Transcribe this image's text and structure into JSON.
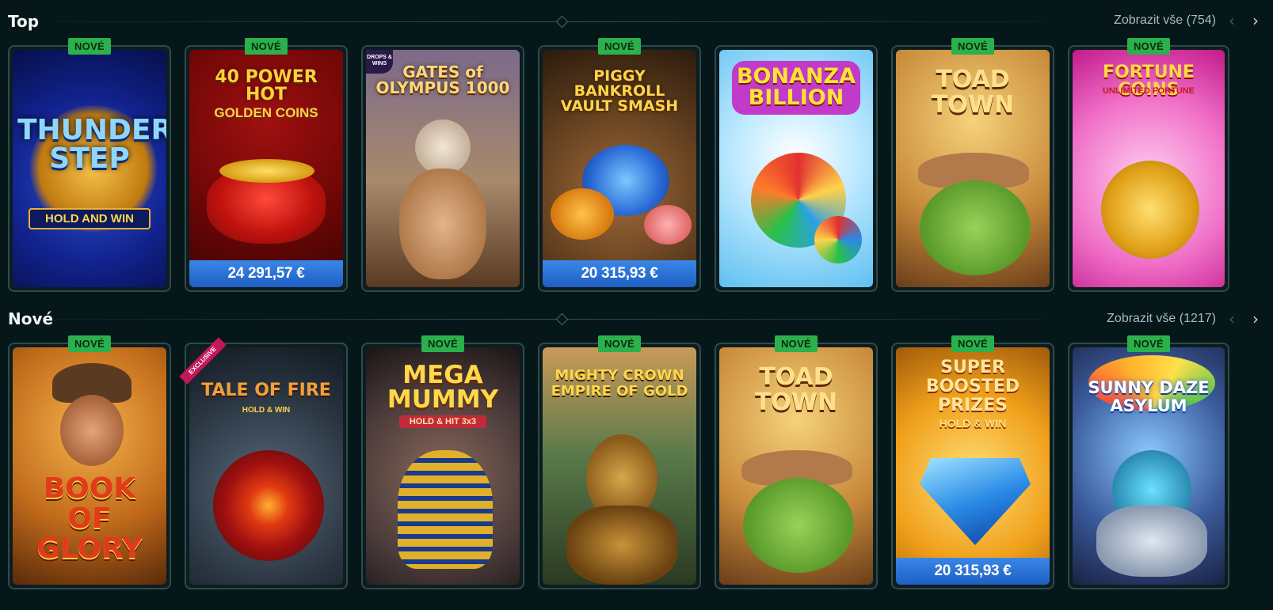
{
  "badge_label": "NOVÉ",
  "sections": {
    "top": {
      "title": "Top",
      "view_all": "Zobrazit vše (754)",
      "cards": [
        {
          "title": "THUNDER STEP",
          "subtitle": "HOLD AND WIN",
          "badge": true,
          "jackpot": ""
        },
        {
          "title": "40 POWER HOT",
          "subtitle": "GOLDEN COINS",
          "badge": true,
          "jackpot": "24 291,57 €"
        },
        {
          "title": "GATES of OLYMPUS 1000",
          "subtitle": "",
          "badge": false,
          "tag": "DROPS & WINS",
          "jackpot": ""
        },
        {
          "title": "PIGGY BANKROLL VAULT SMASH",
          "subtitle": "",
          "badge": true,
          "jackpot": "20 315,93 €"
        },
        {
          "title": "BONANZA BILLION",
          "subtitle": "",
          "badge": false,
          "jackpot": ""
        },
        {
          "title": "TOAD TOWN",
          "subtitle": "",
          "badge": true,
          "jackpot": ""
        },
        {
          "title": "FORTUNE COINS",
          "subtitle": "UNLIMITED FORTUNE",
          "badge": true,
          "jackpot": ""
        }
      ]
    },
    "new": {
      "title": "Nové",
      "view_all": "Zobrazit vše (1217)",
      "cards": [
        {
          "title": "BOOK OF GLORY",
          "subtitle": "",
          "badge": true,
          "jackpot": ""
        },
        {
          "title": "TALE OF FIRE",
          "subtitle": "HOLD & WIN",
          "badge": false,
          "tag": "EXCLUSIVE",
          "jackpot": ""
        },
        {
          "title": "MEGA MUMMY",
          "subtitle": "HOLD & HIT 3x3",
          "badge": true,
          "jackpot": ""
        },
        {
          "title": "MIGHTY CROWN EMPIRE OF GOLD",
          "subtitle": "",
          "badge": true,
          "jackpot": ""
        },
        {
          "title": "TOAD TOWN",
          "subtitle": "",
          "badge": true,
          "jackpot": ""
        },
        {
          "title": "SUPER BOOSTED PRIZES",
          "subtitle": "HOLD & WIN",
          "badge": true,
          "jackpot": "20 315,93 €"
        },
        {
          "title": "SUNNY DAZE ASYLUM",
          "subtitle": "",
          "badge": true,
          "jackpot": ""
        }
      ]
    }
  },
  "colors": {
    "background": "#06171a",
    "badge": "#2bb14b",
    "jackpot": "#2a72d6"
  }
}
